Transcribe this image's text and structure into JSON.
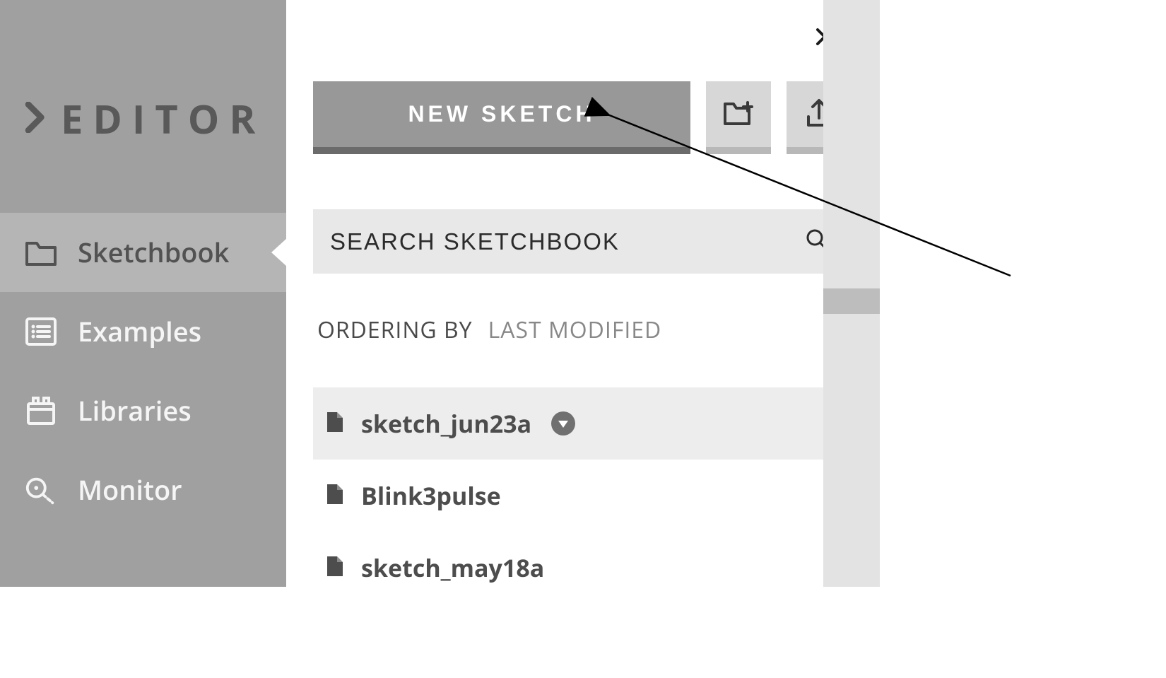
{
  "sidebar": {
    "title": "EDITOR",
    "items": [
      {
        "label": "Sketchbook",
        "icon": "folder-icon",
        "active": true
      },
      {
        "label": "Examples",
        "icon": "list-icon",
        "active": false
      },
      {
        "label": "Libraries",
        "icon": "library-icon",
        "active": false
      },
      {
        "label": "Monitor",
        "icon": "monitor-icon",
        "active": false
      }
    ]
  },
  "toolbar": {
    "new_sketch_label": "NEW SKETCH"
  },
  "search": {
    "placeholder": "SEARCH SKETCHBOOK"
  },
  "ordering": {
    "label": "ORDERING BY",
    "value": "LAST MODIFIED"
  },
  "sketches": [
    {
      "name": "sketch_jun23a",
      "selected": true
    },
    {
      "name": "Blink3pulse",
      "selected": false
    },
    {
      "name": "sketch_may18a",
      "selected": false
    }
  ]
}
